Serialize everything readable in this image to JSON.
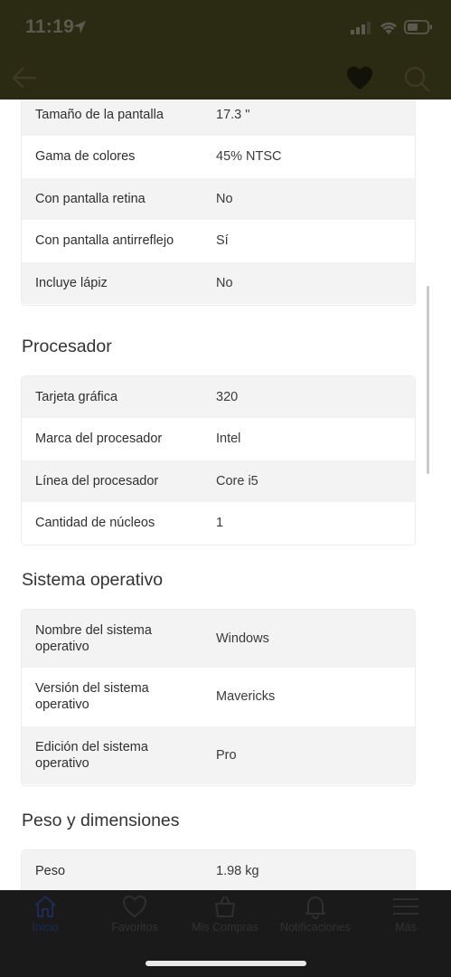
{
  "status_bar": {
    "time": "11:19"
  },
  "sections": {
    "display": {
      "rows": [
        {
          "key": "Tamaño de la pantalla",
          "value": "17.3 \""
        },
        {
          "key": "Gama de colores",
          "value": "45% NTSC"
        },
        {
          "key": "Con pantalla retina",
          "value": "No"
        },
        {
          "key": "Con pantalla antirreflejo",
          "value": "Sí"
        },
        {
          "key": "Incluye lápiz",
          "value": "No"
        }
      ]
    },
    "processor": {
      "title": "Procesador",
      "rows": [
        {
          "key": "Tarjeta gráfica",
          "value": "320"
        },
        {
          "key": "Marca del procesador",
          "value": "Intel"
        },
        {
          "key": "Línea del procesador",
          "value": "Core i5"
        },
        {
          "key": "Cantidad de núcleos",
          "value": "1"
        }
      ]
    },
    "os": {
      "title": "Sistema operativo",
      "rows": [
        {
          "key": "Nombre del sistema operativo",
          "value": "Windows"
        },
        {
          "key": "Versión del sistema operativo",
          "value": "Mavericks"
        },
        {
          "key": "Edición del sistema operativo",
          "value": "Pro"
        }
      ]
    },
    "weight": {
      "title": "Peso y dimensiones",
      "rows": [
        {
          "key": "Peso",
          "value": "1.98 kg"
        }
      ]
    }
  },
  "tabbar": {
    "items": [
      {
        "label": "Inicio",
        "icon": "home-icon"
      },
      {
        "label": "Favoritos",
        "icon": "heart-icon"
      },
      {
        "label": "Mis Compras",
        "icon": "bag-icon"
      },
      {
        "label": "Notificaciones",
        "icon": "bell-icon"
      },
      {
        "label": "Más",
        "icon": "menu-icon"
      }
    ]
  },
  "colors": {
    "header_bg": "#2b2a12",
    "tabbar_bg": "#1a1a1a",
    "active_tab": "#1e2a57"
  }
}
